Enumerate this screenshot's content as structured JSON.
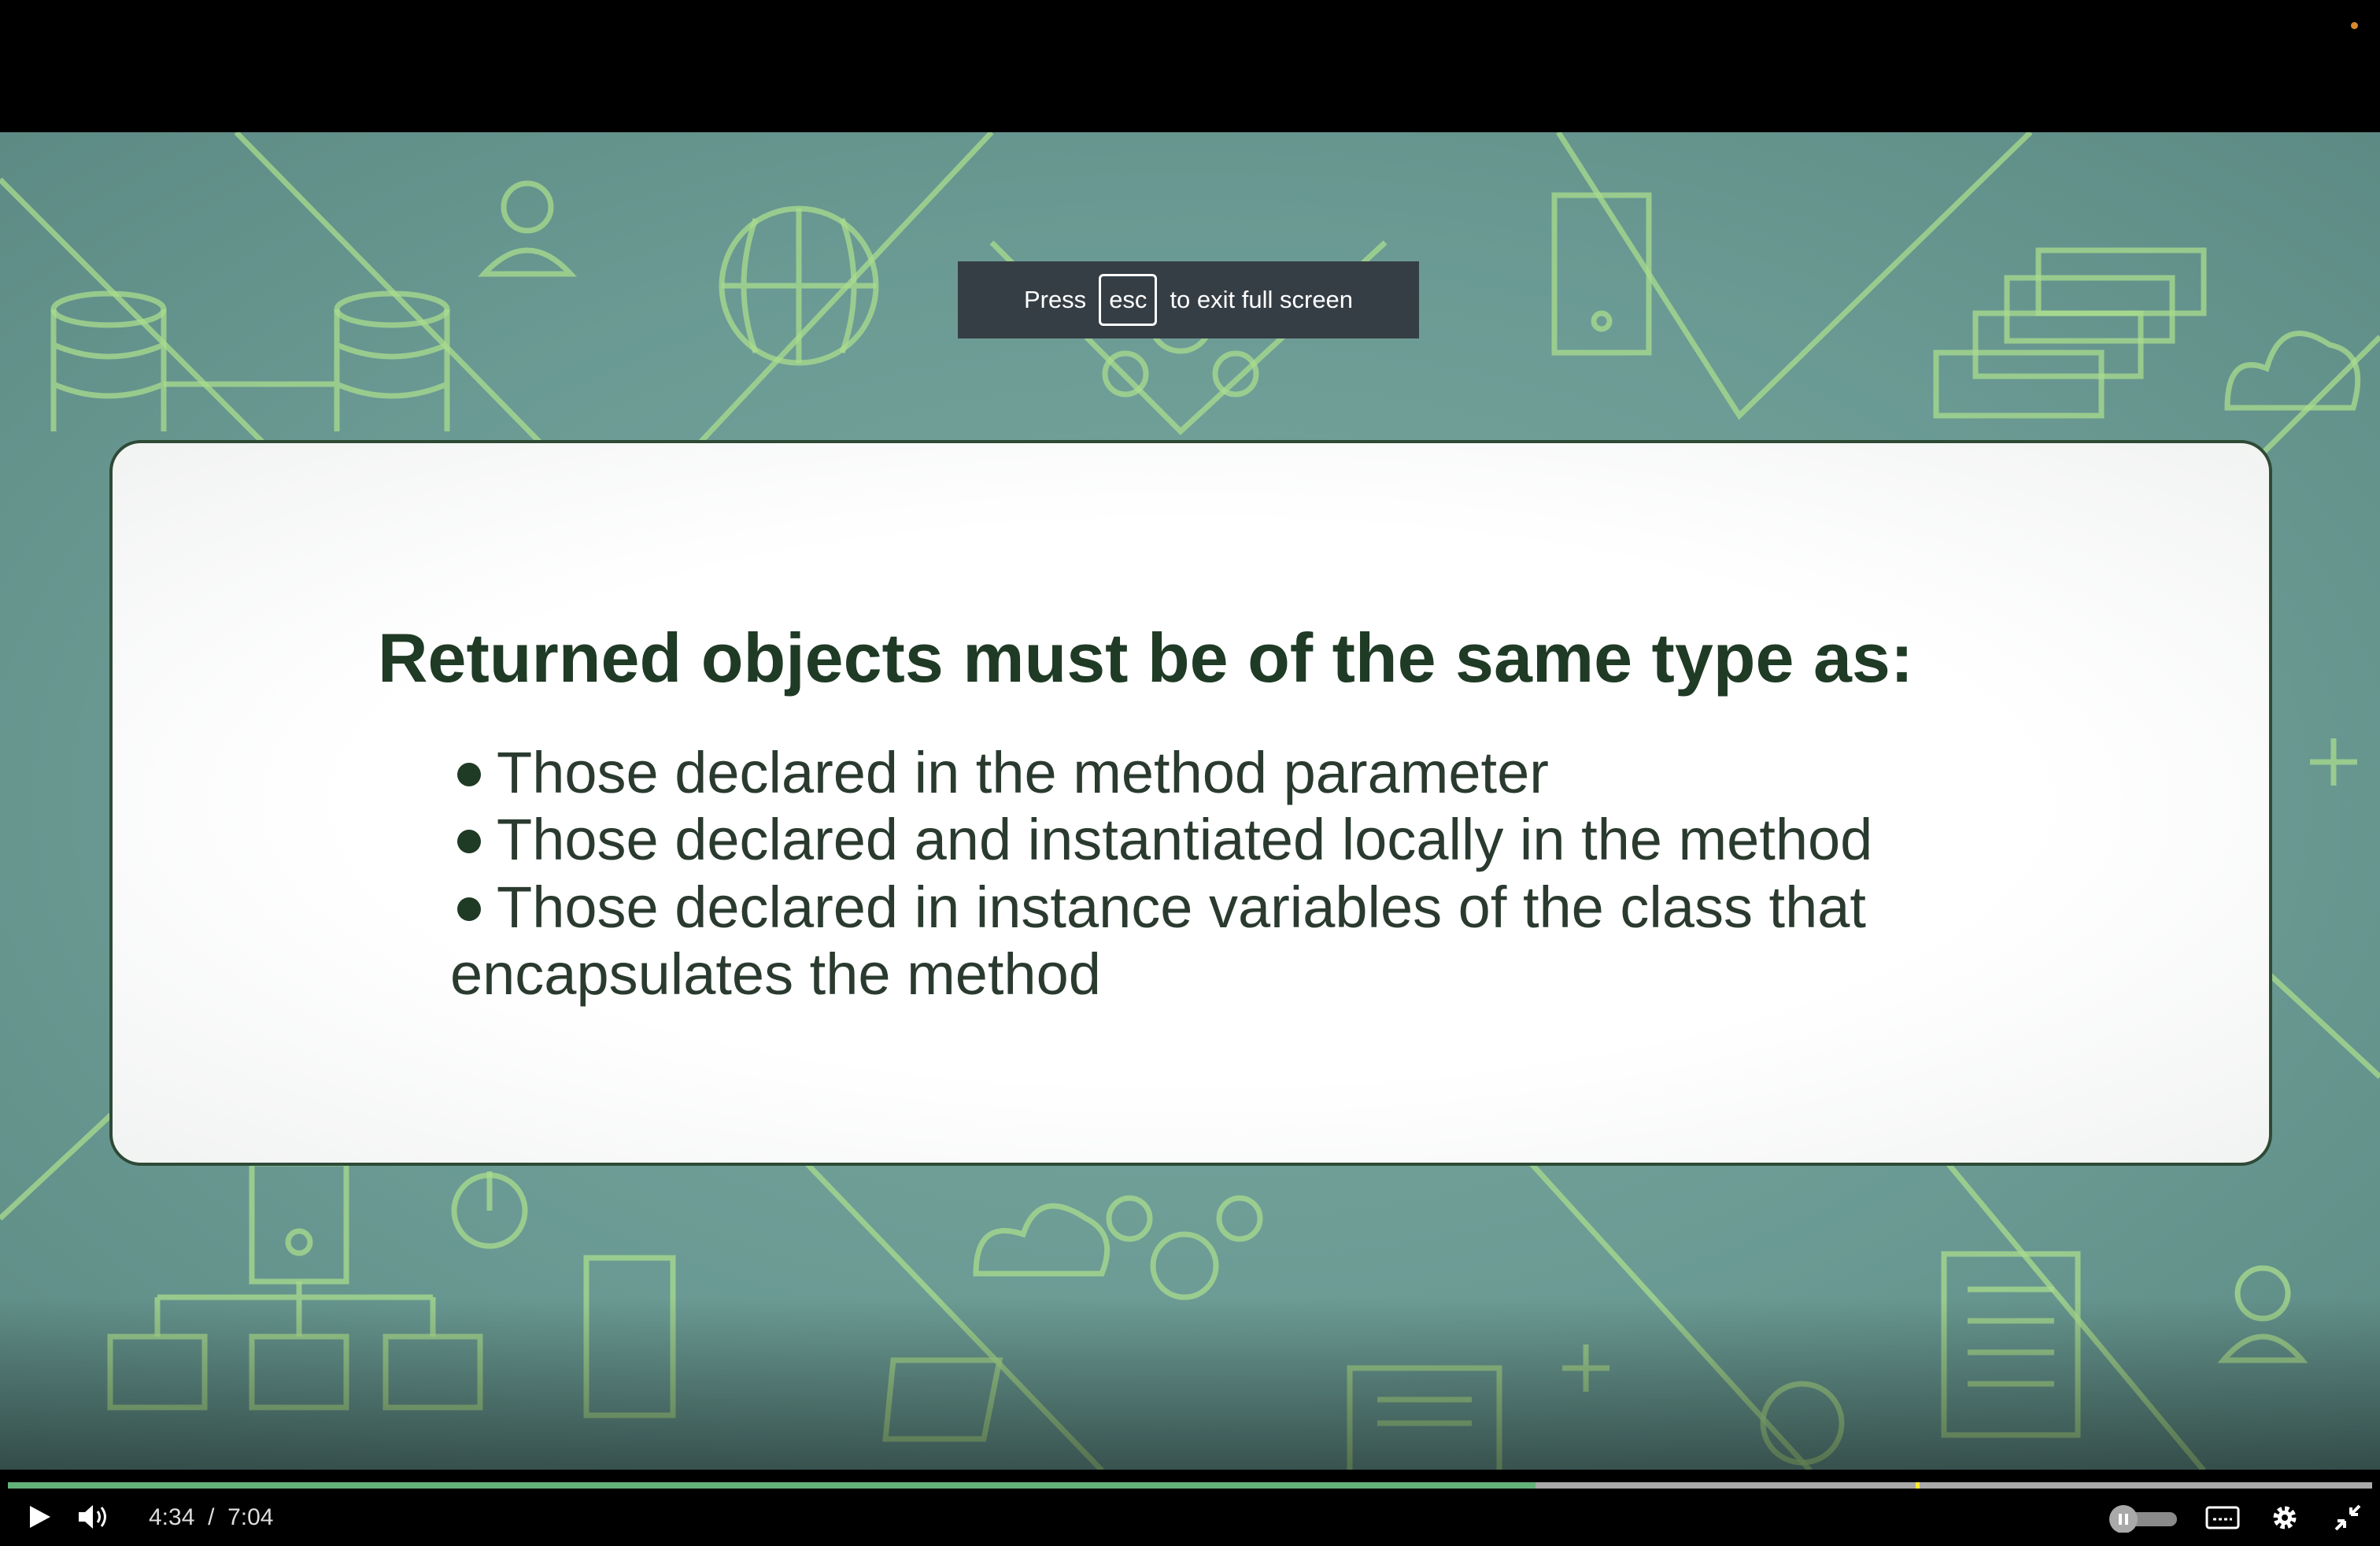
{
  "banner": {
    "press": "Press",
    "key": "esc",
    "suffix": "to exit full screen"
  },
  "slide": {
    "title": "Returned objects must be of the same type as:",
    "bullets": [
      "Those declared in the method parameter",
      "Those declared and instantiated locally in the method",
      "Those declared in instance variables of the class that"
    ],
    "continuation": "encapsulates the method"
  },
  "player": {
    "current_time": "4:34",
    "separator": "/",
    "duration": "7:04",
    "progress_percent": 64.6,
    "marker_percent": 80.7,
    "played_color": "#63b27a"
  }
}
